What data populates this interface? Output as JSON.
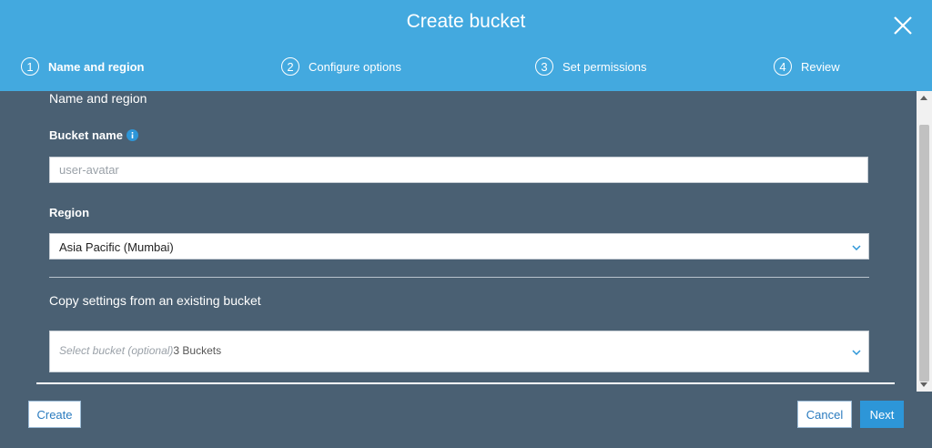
{
  "header": {
    "title": "Create bucket",
    "close_icon": "close-icon",
    "background": "#43a9df"
  },
  "steps": [
    {
      "number": "1",
      "label": "Name and region",
      "active": true
    },
    {
      "number": "2",
      "label": "Configure options",
      "active": false
    },
    {
      "number": "3",
      "label": "Set permissions",
      "active": false
    },
    {
      "number": "4",
      "label": "Review",
      "active": false
    }
  ],
  "form": {
    "section_title": "Name and region",
    "bucket_name": {
      "label": "Bucket name",
      "info_icon": "info-icon",
      "placeholder": "user-avatar",
      "value": ""
    },
    "region": {
      "label": "Region",
      "selected": "Asia Pacific (Mumbai)"
    },
    "copy_settings": {
      "title": "Copy settings from an existing bucket",
      "placeholder": "Select bucket (optional)",
      "count_text": "3 Buckets"
    }
  },
  "footer": {
    "create_label": "Create",
    "cancel_label": "Cancel",
    "next_label": "Next"
  },
  "colors": {
    "body_background": "#4a6073",
    "primary_button": "#2d96d8"
  }
}
